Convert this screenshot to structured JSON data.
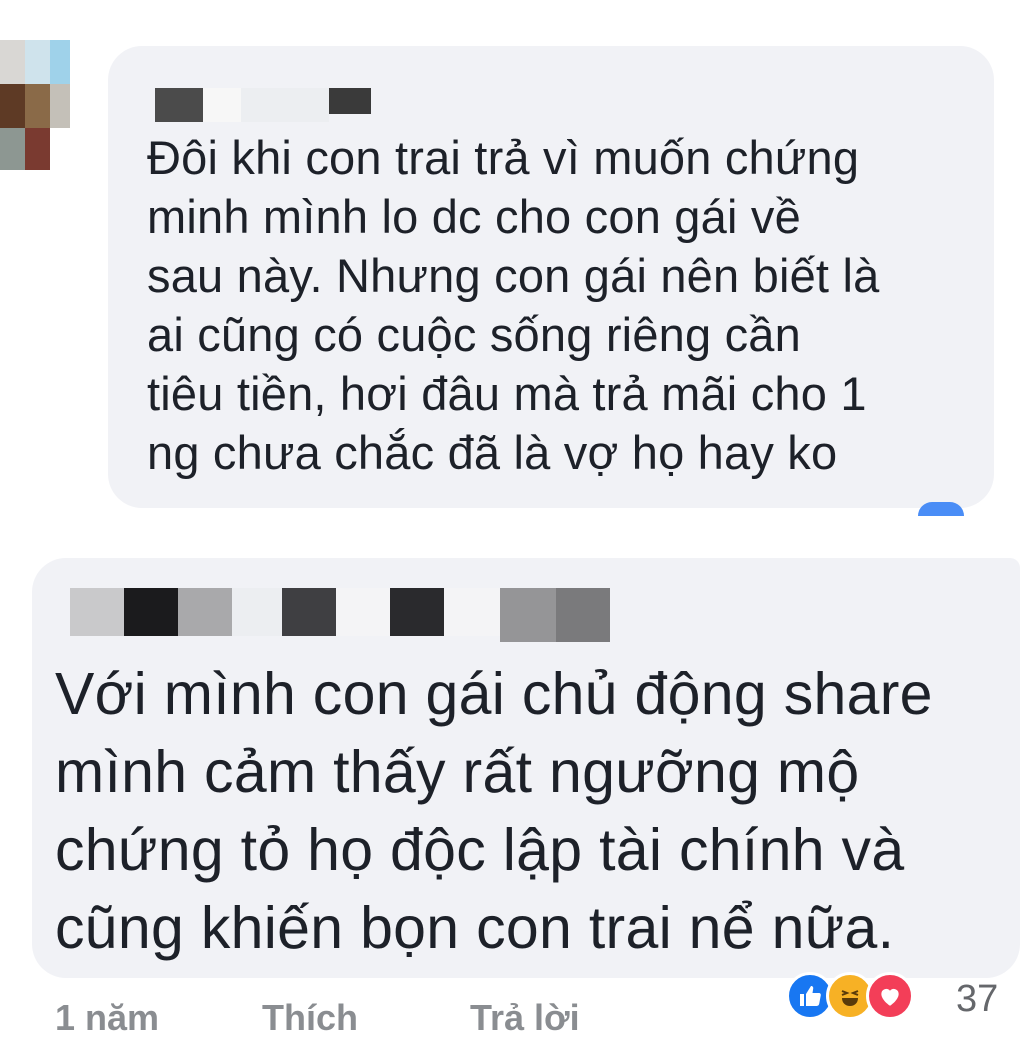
{
  "comments": [
    {
      "text": "Đôi khi con trai trả vì muốn chứng\nminh mình lo dc cho con gái về\nsau này. Nhưng con gái nên biết là\nai cũng có cuộc sống riêng cần\ntiêu tiền, hơi đâu mà trả mãi cho 1\nng chưa chắc đã là vợ họ hay ko"
    },
    {
      "text": "Với mình con gái chủ động share\nmình cảm thấy rất ngưỡng mộ\nchứng tỏ họ độc lập tài chính và\ncũng khiến bọn con trai nể nữa."
    }
  ],
  "footer": {
    "time": "1 năm",
    "like": "Thích",
    "reply": "Trả lời"
  },
  "reactions": {
    "icons": [
      "like-icon",
      "haha-icon",
      "love-icon"
    ],
    "count": "37",
    "colors": {
      "like": "#1877f2",
      "haha": "#f7b125",
      "love": "#f33e58"
    }
  },
  "colors": {
    "bubble": "#f1f2f6",
    "text": "#1d2129",
    "meta": "#8a8d91"
  }
}
